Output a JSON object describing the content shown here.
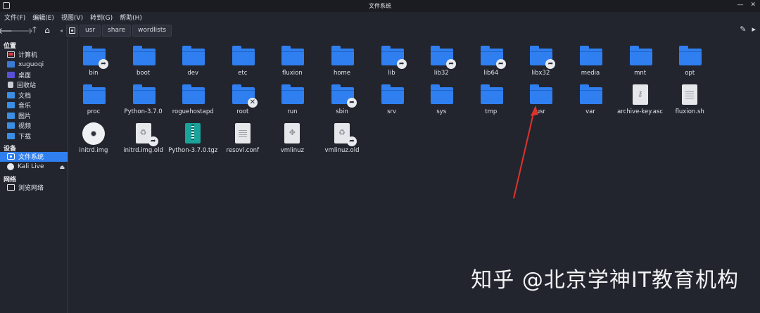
{
  "window": {
    "title": "文件系统"
  },
  "menu": [
    "文件(F)",
    "编辑(E)",
    "视图(V)",
    "转到(G)",
    "帮助(H)"
  ],
  "toolbar": {
    "back": "🡐",
    "forward": "🡒",
    "up": "🡑",
    "home": "⌂",
    "crumb_prev": "◂",
    "crumbs": [
      "usr",
      "share",
      "wordlists"
    ],
    "edit": "✎",
    "next": "▸"
  },
  "sidebar": {
    "sections": [
      {
        "title": "位置",
        "items": [
          {
            "label": "计算机",
            "icon": "computer-icon"
          },
          {
            "label": "xuguoqi",
            "icon": "user-folder-icon"
          },
          {
            "label": "桌面",
            "icon": "desktop-icon"
          },
          {
            "label": "回收站",
            "icon": "trash-icon"
          },
          {
            "label": "文档",
            "icon": "folder-icon"
          },
          {
            "label": "音乐",
            "icon": "folder-icon"
          },
          {
            "label": "图片",
            "icon": "folder-icon"
          },
          {
            "label": "视频",
            "icon": "folder-icon"
          },
          {
            "label": "下载",
            "icon": "folder-icon"
          }
        ]
      },
      {
        "title": "设备",
        "items": [
          {
            "label": "文件系统",
            "icon": "drive-icon",
            "selected": true
          },
          {
            "label": "Kali Live",
            "icon": "kali-icon",
            "eject": "⏏"
          }
        ]
      },
      {
        "title": "网络",
        "items": [
          {
            "label": "浏览网络",
            "icon": "network-icon"
          }
        ]
      }
    ]
  },
  "files": [
    {
      "name": "bin",
      "kind": "folder",
      "link": true
    },
    {
      "name": "boot",
      "kind": "folder"
    },
    {
      "name": "dev",
      "kind": "folder"
    },
    {
      "name": "etc",
      "kind": "folder"
    },
    {
      "name": "fluxion",
      "kind": "folder"
    },
    {
      "name": "home",
      "kind": "folder"
    },
    {
      "name": "lib",
      "kind": "folder",
      "link": true
    },
    {
      "name": "lib32",
      "kind": "folder",
      "link": true
    },
    {
      "name": "lib64",
      "kind": "folder",
      "link": true
    },
    {
      "name": "libx32",
      "kind": "folder",
      "link": true
    },
    {
      "name": "media",
      "kind": "folder"
    },
    {
      "name": "mnt",
      "kind": "folder"
    },
    {
      "name": "opt",
      "kind": "folder"
    },
    {
      "name": "proc",
      "kind": "folder"
    },
    {
      "name": "Python-3.7.0",
      "kind": "folder"
    },
    {
      "name": "roguehostapd",
      "kind": "folder"
    },
    {
      "name": "root",
      "kind": "folder",
      "noaccess": true
    },
    {
      "name": "run",
      "kind": "folder"
    },
    {
      "name": "sbin",
      "kind": "folder",
      "link": true
    },
    {
      "name": "srv",
      "kind": "folder"
    },
    {
      "name": "sys",
      "kind": "folder"
    },
    {
      "name": "tmp",
      "kind": "folder"
    },
    {
      "name": "usr",
      "kind": "folder"
    },
    {
      "name": "var",
      "kind": "folder"
    },
    {
      "name": "archive-key.asc",
      "kind": "key"
    },
    {
      "name": "fluxion.sh",
      "kind": "text"
    },
    {
      "name": "initrd.img",
      "kind": "disc"
    },
    {
      "name": "initrd.img.old",
      "kind": "recycle",
      "link": true
    },
    {
      "name": "Python-3.7.0.tgz",
      "kind": "archive"
    },
    {
      "name": "resovl.conf",
      "kind": "text"
    },
    {
      "name": "vmlinuz",
      "kind": "exec"
    },
    {
      "name": "vmlinuz.old",
      "kind": "recycle",
      "link": true
    }
  ],
  "watermark": "知乎 @北京学神IT教育机构",
  "colors": {
    "accent": "#2f7ff0",
    "annotation": "#e0322d",
    "background": "#23252e"
  }
}
